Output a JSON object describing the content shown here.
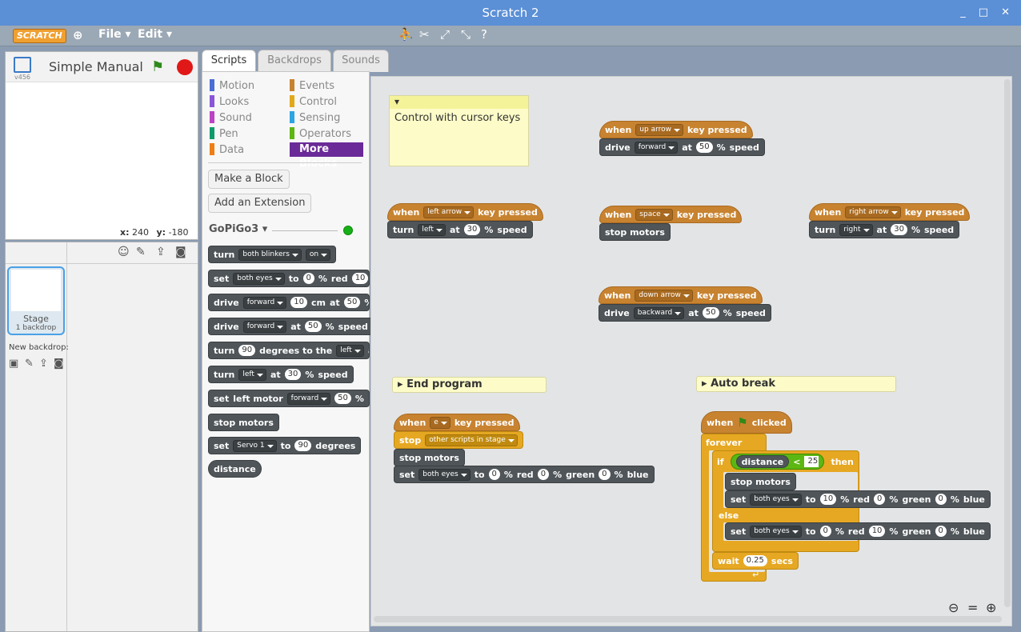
{
  "window": {
    "title": "Scratch 2",
    "controls": [
      "_",
      "□",
      "✕"
    ]
  },
  "menubar": {
    "logo": "SCRATCH",
    "file": "File ▾",
    "edit": "Edit ▾"
  },
  "stage": {
    "title": "Simple Manual",
    "version": "v456",
    "coords_x_label": "x:",
    "coords_x": "240",
    "coords_y_label": "y:",
    "coords_y": "-180"
  },
  "sprites": {
    "stage_name": "Stage",
    "stage_sub": "1 backdrop",
    "new_backdrop": "New backdrop:"
  },
  "tabs": [
    {
      "label": "Scripts"
    },
    {
      "label": "Backdrops"
    },
    {
      "label": "Sounds"
    }
  ],
  "categories": {
    "left": [
      {
        "label": "Motion",
        "color": "#4a6cd4"
      },
      {
        "label": "Looks",
        "color": "#8a55d7"
      },
      {
        "label": "Sound",
        "color": "#bb42c3"
      },
      {
        "label": "Pen",
        "color": "#0e9a6c"
      },
      {
        "label": "Data",
        "color": "#ee7d16"
      }
    ],
    "right": [
      {
        "label": "Events",
        "color": "#c88330"
      },
      {
        "label": "Control",
        "color": "#e1a91a"
      },
      {
        "label": "Sensing",
        "color": "#2ca5e2"
      },
      {
        "label": "Operators",
        "color": "#5cb712"
      },
      {
        "label": "More Blocks",
        "color": "#632d99"
      }
    ]
  },
  "palette": {
    "make_block": "Make a Block",
    "add_extension": "Add an Extension",
    "extension_name": "GoPiGo3 ▾",
    "b_turn": "turn",
    "both_blinkers": "both blinkers",
    "on": "on",
    "set": "set",
    "both_eyes": "both eyes",
    "to": "to",
    "zero": "0",
    "red": "red",
    "ten": "10",
    "drive": "drive",
    "forward": "forward",
    "cm": "cm",
    "at": "at",
    "fifty": "50",
    "percent": "%",
    "speed": "speed",
    "ninety": "90",
    "degrees_to_the": "degrees to the",
    "left": "left",
    "thirty": "30",
    "left_motor": "left motor",
    "stop_motors": "stop motors",
    "servo1": "Servo 1",
    "degrees": "degrees",
    "distance": "distance"
  },
  "scripts": {
    "comment": "Control with cursor keys",
    "when": "when",
    "key_pressed": "key pressed",
    "up_arrow": "up arrow",
    "left_arrow": "left arrow",
    "space": "space",
    "right_arrow": "right arrow",
    "down_arrow": "down arrow",
    "backward": "backward",
    "right": "right",
    "end_program": "End program",
    "auto_break": "Auto break",
    "e": "e",
    "stop": "stop",
    "other_scripts": "other scripts in stage",
    "green": "green",
    "blue": "blue",
    "clicked": "clicked",
    "forever": "forever",
    "if": "if",
    "lt": "<",
    "twentyfive": "25",
    "then": "then",
    "else": "else",
    "wait": "wait",
    "wait_val": "0.25",
    "secs": "secs"
  }
}
